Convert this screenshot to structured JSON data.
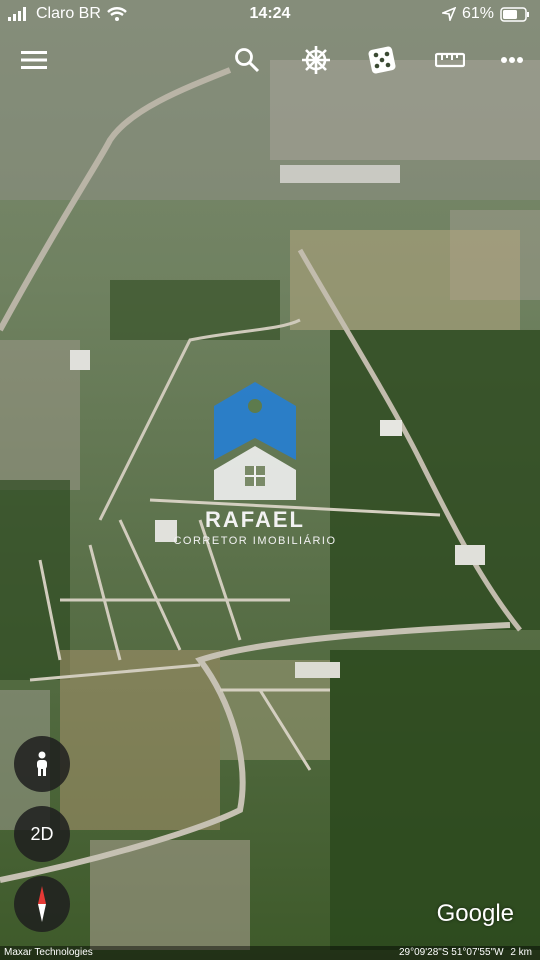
{
  "status_bar": {
    "carrier": "Claro BR",
    "time": "14:24",
    "battery": "61%"
  },
  "toolbar": {
    "icons": [
      "menu-icon",
      "search-icon",
      "voyager-wheel-icon",
      "dice-icon",
      "ruler-icon",
      "more-icon"
    ]
  },
  "watermark": {
    "name": "RAFAEL",
    "subtitle": "CORRETOR IMOBILIÁRIO"
  },
  "controls": {
    "mode_2d_label": "2D"
  },
  "logo": "Google",
  "footer": {
    "attribution": "Maxar Technologies",
    "coordinates": "29°09'28\"S 51°07'55\"W",
    "scale": "2 km"
  }
}
